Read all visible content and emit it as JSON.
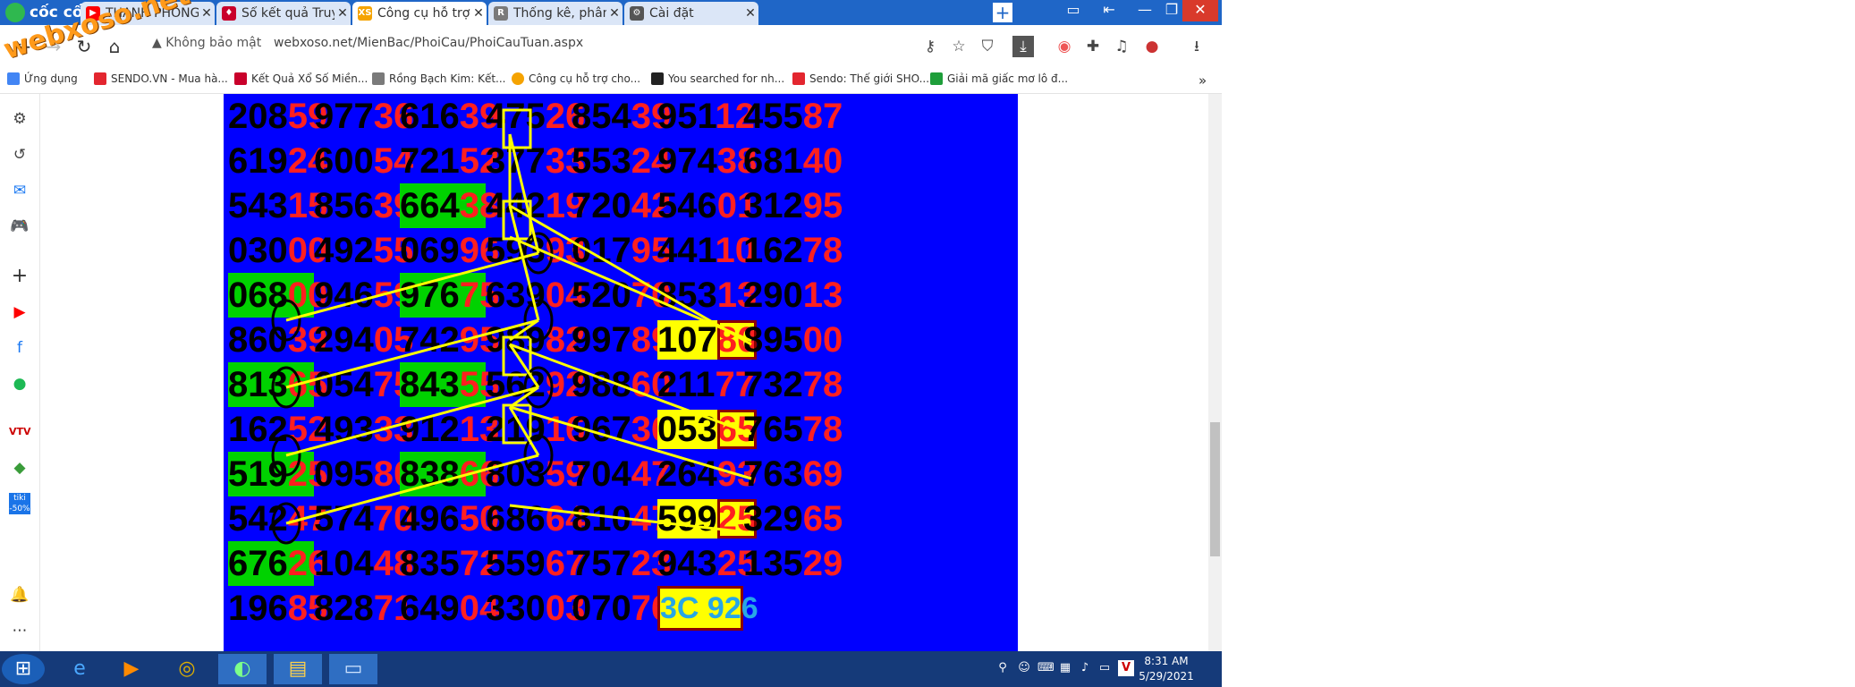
{
  "brand": "cốc cốc",
  "tabs": [
    {
      "title": "THANH PHONG SOI C",
      "icon": "youtube-icon",
      "color": "#ff0000",
      "active": false
    },
    {
      "title": "Sổ kết quả Truyền Thố",
      "icon": "lottery-icon",
      "color": "#c9002b",
      "active": false
    },
    {
      "title": "Công cụ hỗ trợ cho ng",
      "icon": "xs-icon",
      "color": "#f5a300",
      "active": true
    },
    {
      "title": "Thống kê, phân tích k",
      "icon": "rbk-icon",
      "color": "#7a7a7a",
      "active": false
    },
    {
      "title": "Cài đặt",
      "icon": "gear-icon",
      "color": "#555555",
      "active": false
    }
  ],
  "address": {
    "security": "Không bảo mật",
    "url": "webxoso.net/MienBac/PhoiCau/PhoiCauTuan.aspx"
  },
  "bookmarks": [
    {
      "label": "Ứng dụng",
      "color": "#4285f4"
    },
    {
      "label": "SENDO.VN - Mua hà...",
      "color": "#e3262f"
    },
    {
      "label": "Kết Quả Xổ Số Miền...",
      "color": "#c9002b"
    },
    {
      "label": "Rồng Bạch Kim: Kết...",
      "color": "#7a7a7a"
    },
    {
      "label": "Công cụ hỗ trợ cho...",
      "color": "#f5a300"
    },
    {
      "label": "You searched for nh...",
      "color": "#222222"
    },
    {
      "label": "Sendo: Thế giới SHO...",
      "color": "#e3262f"
    },
    {
      "label": "Giải mã giấc mơ lô đ...",
      "color": "#1e9e3a"
    }
  ],
  "bookmarks_more": "»",
  "watermark": "webxoso.net",
  "grid": [
    [
      "20859",
      "97736",
      "61639",
      "47526",
      "85439",
      "95112",
      "45587"
    ],
    [
      "61924",
      "60054",
      "72152",
      "37733",
      "55324",
      "97438",
      "68140"
    ],
    [
      "54315",
      "85639",
      "66438",
      "44219",
      "72042",
      "54601",
      "31295"
    ],
    [
      "03000",
      "49255",
      "06996",
      "59393",
      "01795",
      "44110",
      "16278"
    ],
    [
      "06800",
      "94659",
      "97675",
      "63904",
      "52070",
      "85313",
      "29013"
    ],
    [
      "86039",
      "29405",
      "74295",
      "98982",
      "99789",
      "10780",
      "89500"
    ],
    [
      "81365",
      "05475",
      "84355",
      "56292",
      "98860",
      "21177",
      "73278"
    ],
    [
      "16252",
      "49333",
      "91213",
      "21916",
      "96736",
      "05365",
      "76578"
    ],
    [
      "51925",
      "09580",
      "83866",
      "80359",
      "70447",
      "26493",
      "76369"
    ],
    [
      "54247",
      "57470",
      "49650",
      "68664",
      "81047",
      "59925",
      "32965"
    ],
    [
      "67626",
      "10448",
      "83572",
      "55967",
      "75723",
      "94325",
      "13529"
    ],
    [
      "19685",
      "82871",
      "64904",
      "33003",
      "07076",
      "3C 926",
      ""
    ]
  ],
  "highlights": {
    "green": [
      [
        2,
        2
      ],
      [
        4,
        0
      ],
      [
        4,
        2
      ],
      [
        6,
        0
      ],
      [
        6,
        2
      ],
      [
        8,
        0
      ],
      [
        8,
        2
      ],
      [
        10,
        0
      ]
    ],
    "yellow": [
      [
        5,
        5
      ],
      [
        7,
        5
      ],
      [
        9,
        5
      ]
    ]
  },
  "board_colors": {
    "background": "#0000ff",
    "prefix": "#000000",
    "suffix": "#ff1f1f",
    "green": "#00d200",
    "yellow": "#ffff00",
    "box_border": "#8b0000",
    "link": "#ffff00",
    "final_text": "#27a6e6"
  },
  "taskbar": {
    "time": "8:31 AM",
    "date": "5/29/2021",
    "apps": [
      "start-button",
      "internet-explorer-icon",
      "media-player-icon",
      "chrome-icon",
      "coccoc-icon",
      "file-explorer-icon",
      "display-icon"
    ]
  }
}
